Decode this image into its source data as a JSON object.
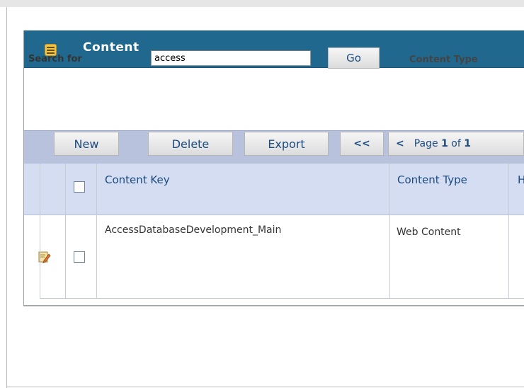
{
  "panel": {
    "title": "Content"
  },
  "search": {
    "label": "Search for",
    "value": "access",
    "go_label": "Go",
    "content_type_label": "Content Type"
  },
  "toolbar": {
    "new_label": "New",
    "delete_label": "Delete",
    "export_label": "Export",
    "first_label": "<<",
    "prev_label": "<",
    "page_prefix": "Page",
    "page_current": "1",
    "page_of": "of",
    "page_total": "1"
  },
  "table": {
    "columns": [
      {
        "label": "Content Key"
      },
      {
        "label": "Content Type"
      },
      {
        "label": "H"
      }
    ],
    "rows": [
      {
        "content_key": "AccessDatabaseDevelopment_Main",
        "content_type": "Web Content"
      }
    ]
  },
  "icons": {
    "panel": "menu-icon",
    "row_edit": "edit-pencil-icon"
  },
  "colors": {
    "header_bg": "#21688f",
    "toolbar_bg": "#b8c2dc",
    "table_header_bg": "#d5ddf2",
    "accent": "#f1c54a"
  }
}
